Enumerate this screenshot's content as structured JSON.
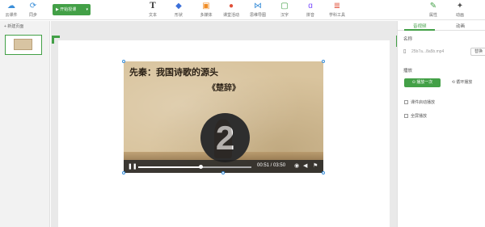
{
  "toolbar": {
    "cloud_label": "云课件",
    "sync_label": "同步",
    "start_label": "开始授课",
    "text_label": "文本",
    "shape_label": "形状",
    "media_label": "多媒体",
    "table_label": "课堂活动",
    "teach_label": "思维导图",
    "mindmap_label": "学科工具",
    "subject_label": "汉字",
    "pinyin_label": "拼音",
    "tools_label": "学科工具",
    "attr_label": "属性",
    "anim_label": "动画"
  },
  "left": {
    "new_page_label": "+ 新建页面"
  },
  "video": {
    "title": "先秦：我国诗歌的源头",
    "subtitle": "《楚辞》",
    "countdown": "2",
    "time": "00:51 / 03:50",
    "progress": 0.55
  },
  "right": {
    "tab_video": "音视频",
    "tab_anim": "动画",
    "name_label": "名称",
    "file_name": "25b7a...8a5b.mp4",
    "replace_label": "替换",
    "play_label": "播放",
    "play_once": "播放一次",
    "play_loop": "循环播放",
    "auto_label": "课件启动播放",
    "full_label": "全屏播放"
  },
  "colors": {
    "accent": "#43a047",
    "handle": "#3b8fd9"
  }
}
